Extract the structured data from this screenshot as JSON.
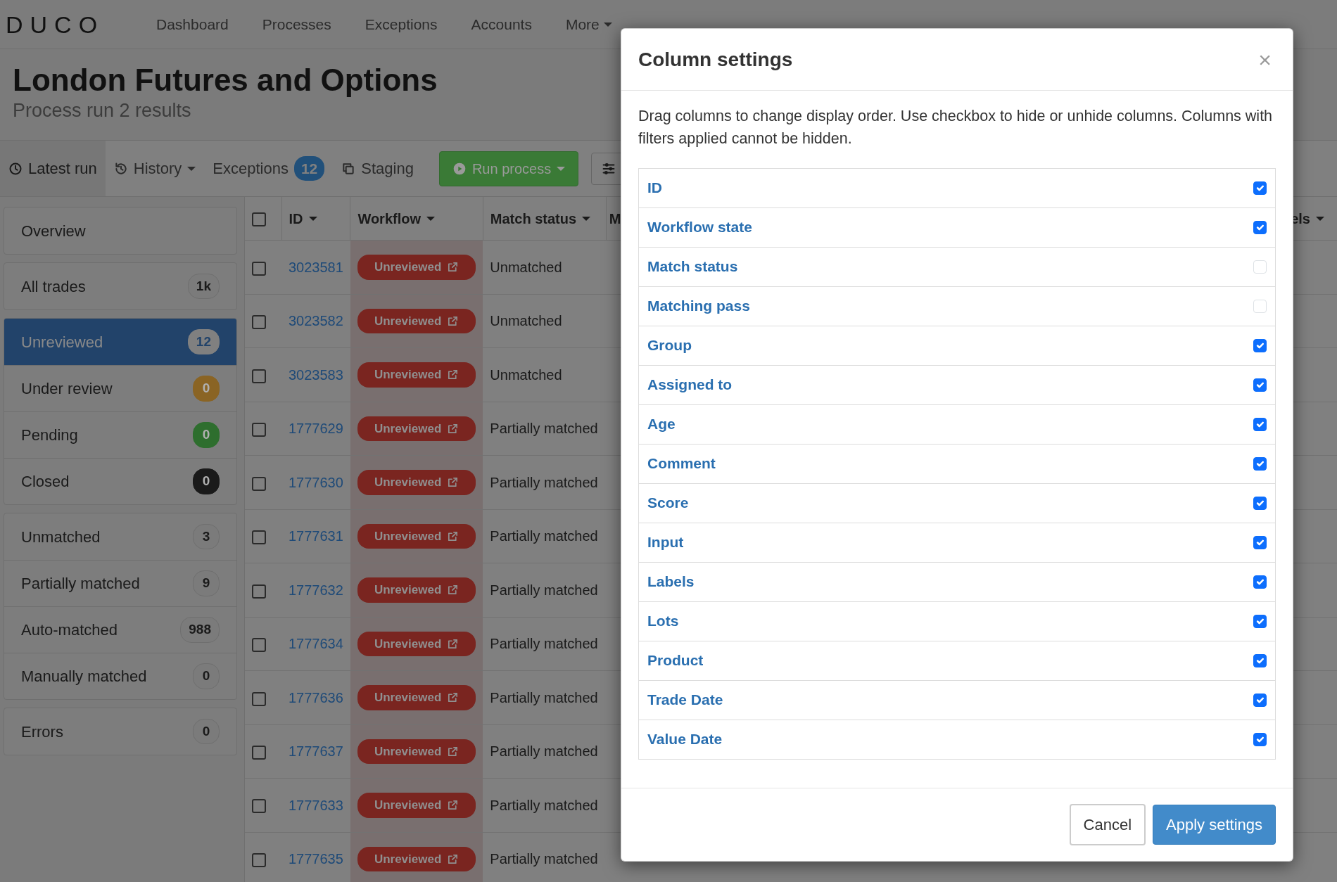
{
  "navbar": {
    "brand": "DUCO",
    "items": [
      {
        "label": "Dashboard",
        "dropdown": false
      },
      {
        "label": "Processes",
        "dropdown": false
      },
      {
        "label": "Exceptions",
        "dropdown": false
      },
      {
        "label": "Accounts",
        "dropdown": false
      },
      {
        "label": "More",
        "dropdown": true
      }
    ]
  },
  "header": {
    "title": "London Futures and Options",
    "subtitle": "Process run 2 results"
  },
  "tabs": [
    {
      "label": "Latest run",
      "selected": true,
      "dropdown": false
    },
    {
      "label": "History",
      "selected": false,
      "dropdown": true
    },
    {
      "label": "Exceptions",
      "selected": false,
      "dropdown": false,
      "count": "12"
    },
    {
      "label": "Staging",
      "selected": false,
      "dropdown": false
    }
  ],
  "run_button": {
    "label": "Run process"
  },
  "sidebar": {
    "groups": [
      [
        {
          "label": "Overview",
          "selected": false
        }
      ],
      [
        {
          "label": "All trades",
          "selected": false,
          "count": "1k",
          "color": "#7b7b7b"
        }
      ],
      [
        {
          "label": "Unreviewed",
          "selected": true,
          "count": "12",
          "color": "#808080"
        },
        {
          "label": "Under review",
          "selected": false,
          "count": "0",
          "color": "#8a6424"
        },
        {
          "label": "Pending",
          "selected": false,
          "count": "0",
          "color": "#2e6e2e"
        },
        {
          "label": "Closed",
          "selected": false,
          "count": "0",
          "color": "#1a1a1a"
        }
      ],
      [
        {
          "label": "Unmatched",
          "selected": false,
          "count": "3",
          "color": "#7b7b7b"
        },
        {
          "label": "Partially matched",
          "selected": false,
          "count": "9",
          "color": "#7b7b7b"
        },
        {
          "label": "Auto-matched",
          "selected": false,
          "count": "988",
          "color": "#7b7b7b"
        },
        {
          "label": "Manually matched",
          "selected": false,
          "count": "0",
          "color": "#7b7b7b"
        }
      ],
      [
        {
          "label": "Errors",
          "selected": false,
          "count": "0",
          "color": "#7b7b7b"
        }
      ]
    ]
  },
  "table": {
    "select_all": {
      "checked": false
    },
    "columns": [
      "ID",
      "Workflow",
      "Match status",
      "M",
      "els"
    ],
    "rows": [
      {
        "id": "3023581",
        "workflow": "Unreviewed",
        "match_status": "Unmatched",
        "checked": false
      },
      {
        "id": "3023582",
        "workflow": "Unreviewed",
        "match_status": "Unmatched",
        "checked": false
      },
      {
        "id": "3023583",
        "workflow": "Unreviewed",
        "match_status": "Unmatched",
        "checked": false
      },
      {
        "id": "1777629",
        "workflow": "Unreviewed",
        "match_status": "Partially matched",
        "checked": false
      },
      {
        "id": "1777630",
        "workflow": "Unreviewed",
        "match_status": "Partially matched",
        "checked": false
      },
      {
        "id": "1777631",
        "workflow": "Unreviewed",
        "match_status": "Partially matched",
        "checked": false
      },
      {
        "id": "1777632",
        "workflow": "Unreviewed",
        "match_status": "Partially matched",
        "checked": false
      },
      {
        "id": "1777634",
        "workflow": "Unreviewed",
        "match_status": "Partially matched",
        "checked": false
      },
      {
        "id": "1777636",
        "workflow": "Unreviewed",
        "match_status": "Partially matched",
        "checked": false
      },
      {
        "id": "1777637",
        "workflow": "Unreviewed",
        "match_status": "Partially matched",
        "checked": false
      },
      {
        "id": "1777633",
        "workflow": "Unreviewed",
        "match_status": "Partially matched",
        "checked": false
      },
      {
        "id": "1777635",
        "workflow": "Unreviewed",
        "match_status": "Partially matched",
        "checked": false
      }
    ]
  },
  "modal": {
    "title": "Column settings",
    "close": "×",
    "description": "Drag columns to change display order. Use checkbox to hide or unhide columns. Columns with filters applied cannot be hidden.",
    "columns": [
      {
        "label": "ID",
        "checked": true
      },
      {
        "label": "Workflow state",
        "checked": true
      },
      {
        "label": "Match status",
        "checked": false
      },
      {
        "label": "Matching pass",
        "checked": false
      },
      {
        "label": "Group",
        "checked": true
      },
      {
        "label": "Assigned to",
        "checked": true
      },
      {
        "label": "Age",
        "checked": true
      },
      {
        "label": "Comment",
        "checked": true
      },
      {
        "label": "Score",
        "checked": true
      },
      {
        "label": "Input",
        "checked": true
      },
      {
        "label": "Labels",
        "checked": true
      },
      {
        "label": "Lots",
        "checked": true
      },
      {
        "label": "Product",
        "checked": true
      },
      {
        "label": "Trade Date",
        "checked": true
      },
      {
        "label": "Value Date",
        "checked": true
      }
    ],
    "buttons": [
      {
        "label": "Cancel",
        "kind": "secondary"
      },
      {
        "label": "Apply settings",
        "kind": "primary"
      }
    ]
  }
}
